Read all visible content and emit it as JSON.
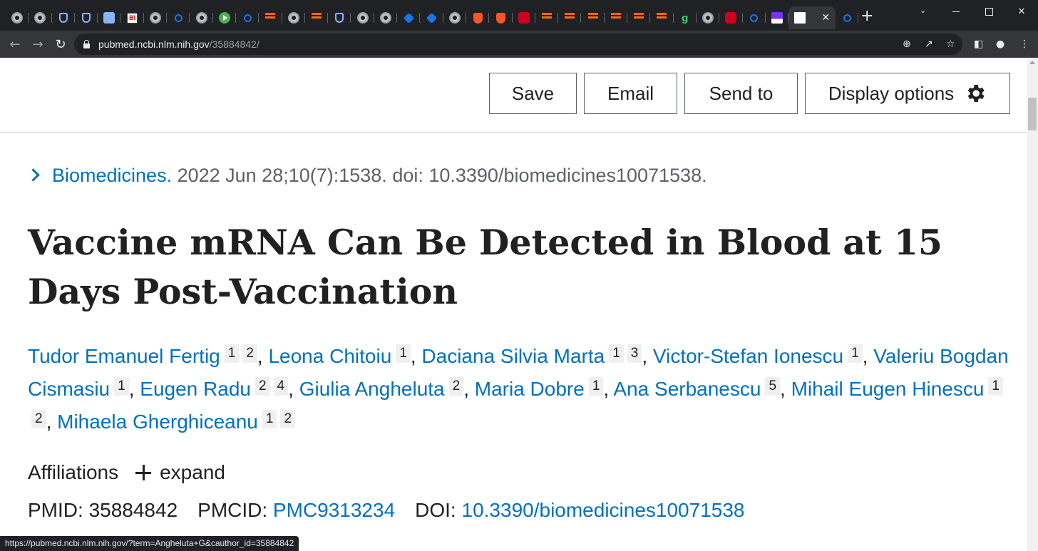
{
  "browser": {
    "tab_favicons": [
      "chrome-icon",
      "globe-icon",
      "shield-icon",
      "shield-icon",
      "arrow-icon",
      "bi-icon",
      "globe-icon",
      "search-icon",
      "globe-icon",
      "play-icon",
      "search-icon",
      "substack-icon",
      "globe-icon",
      "substack-icon",
      "shield-icon",
      "globe-icon",
      "globe-icon",
      "cube-icon",
      "cube-icon",
      "globe-icon",
      "brave-icon",
      "brave-icon",
      "red-icon",
      "substack-icon",
      "substack-icon",
      "substack-icon",
      "substack-icon",
      "substack-icon",
      "substack-icon",
      "g-icon",
      "globe-icon",
      "red-icon",
      "search-icon",
      "purple-icon"
    ],
    "active_tab_close": "✕",
    "new_tab": "+",
    "url_host": "pubmed.ncbi.nlm.nih.gov",
    "url_path": "/35884842/",
    "status_url": "https://pubmed.ncbi.nlm.nih.gov/?term=Angheluta+G&cauthor_id=35884842"
  },
  "actions": {
    "save": "Save",
    "email": "Email",
    "send_to": "Send to",
    "display_options": "Display options"
  },
  "citation": {
    "journal": "Biomedicines.",
    "details": " 2022 Jun 28;10(7):1538. doi: 10.3390/biomedicines10071538."
  },
  "article": {
    "title": "Vaccine mRNA Can Be Detected in Blood at 15 Days Post-Vaccination"
  },
  "authors": [
    {
      "name": "Tudor Emanuel Fertig",
      "affs": [
        "1",
        "2"
      ]
    },
    {
      "name": "Leona Chitoiu",
      "affs": [
        "1"
      ]
    },
    {
      "name": "Daciana Silvia Marta",
      "affs": [
        "1",
        "3"
      ]
    },
    {
      "name": "Victor-Stefan Ionescu",
      "affs": [
        "1"
      ]
    },
    {
      "name": "Valeriu Bogdan Cismasiu",
      "affs": [
        "1"
      ]
    },
    {
      "name": "Eugen Radu",
      "affs": [
        "2",
        "4"
      ]
    },
    {
      "name": "Giulia Angheluta",
      "affs": [
        "2"
      ]
    },
    {
      "name": "Maria Dobre",
      "affs": [
        "1"
      ]
    },
    {
      "name": "Ana Serbanescu",
      "affs": [
        "5"
      ]
    },
    {
      "name": "Mihail Eugen Hinescu",
      "affs": [
        "1",
        "2"
      ]
    },
    {
      "name": "Mihaela Gherghiceanu",
      "affs": [
        "1",
        "2"
      ]
    }
  ],
  "affiliations": {
    "label": "Affiliations",
    "expand": "expand"
  },
  "identifiers": {
    "pmid_label": "PMID: ",
    "pmid": "35884842",
    "pmcid_label": "PMCID: ",
    "pmcid": "PMC9313234",
    "doi_label": "DOI: ",
    "doi": "10.3390/biomedicines10071538"
  },
  "colors": {
    "link": "#0071bc",
    "text": "#212121",
    "muted": "#5b616b",
    "chrome_dark": "#202124",
    "chrome_toolbar": "#35363a"
  }
}
